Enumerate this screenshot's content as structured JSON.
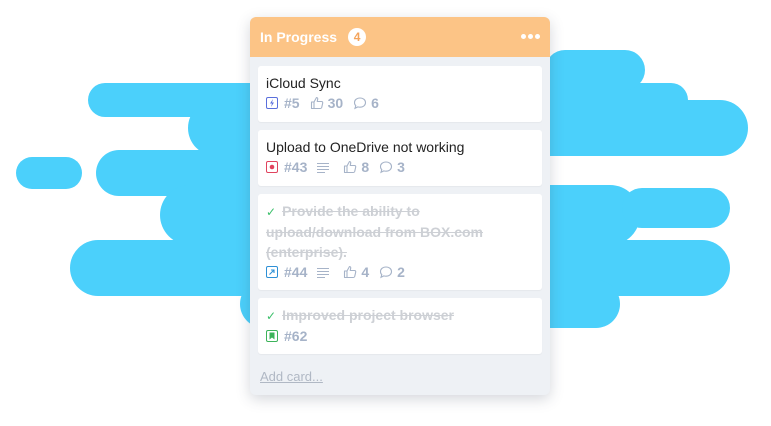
{
  "colors": {
    "blob": "#4bd0fb",
    "header": "#fcc486",
    "column_bg": "#eef1f5",
    "done_check": "#3cc06b"
  },
  "column": {
    "title": "In Progress",
    "count": "4",
    "menu_icon": "more-dots-icon"
  },
  "cards": [
    {
      "title": "iCloud Sync",
      "done": false,
      "type_icon": "lightning-icon",
      "type_color": "#5a6fdc",
      "number": "#5",
      "has_description": false,
      "votes": "30",
      "comments": "6"
    },
    {
      "title": "Upload to OneDrive not working",
      "done": false,
      "type_icon": "bug-icon",
      "type_color": "#e0435e",
      "number": "#43",
      "has_description": true,
      "votes": "8",
      "comments": "3"
    },
    {
      "title_lines": [
        "Provide the ability to",
        "upload/download from BOX.com",
        "(enterprise)."
      ],
      "done": true,
      "type_icon": "external-arrow-icon",
      "type_color": "#2e90d6",
      "number": "#44",
      "has_description": true,
      "votes": "4",
      "comments": "2"
    },
    {
      "title": "Improved project browser",
      "done": true,
      "type_icon": "bookmark-icon",
      "type_color": "#3cb35a",
      "number": "#62",
      "has_description": false
    }
  ],
  "add_card_label": "Add card..."
}
